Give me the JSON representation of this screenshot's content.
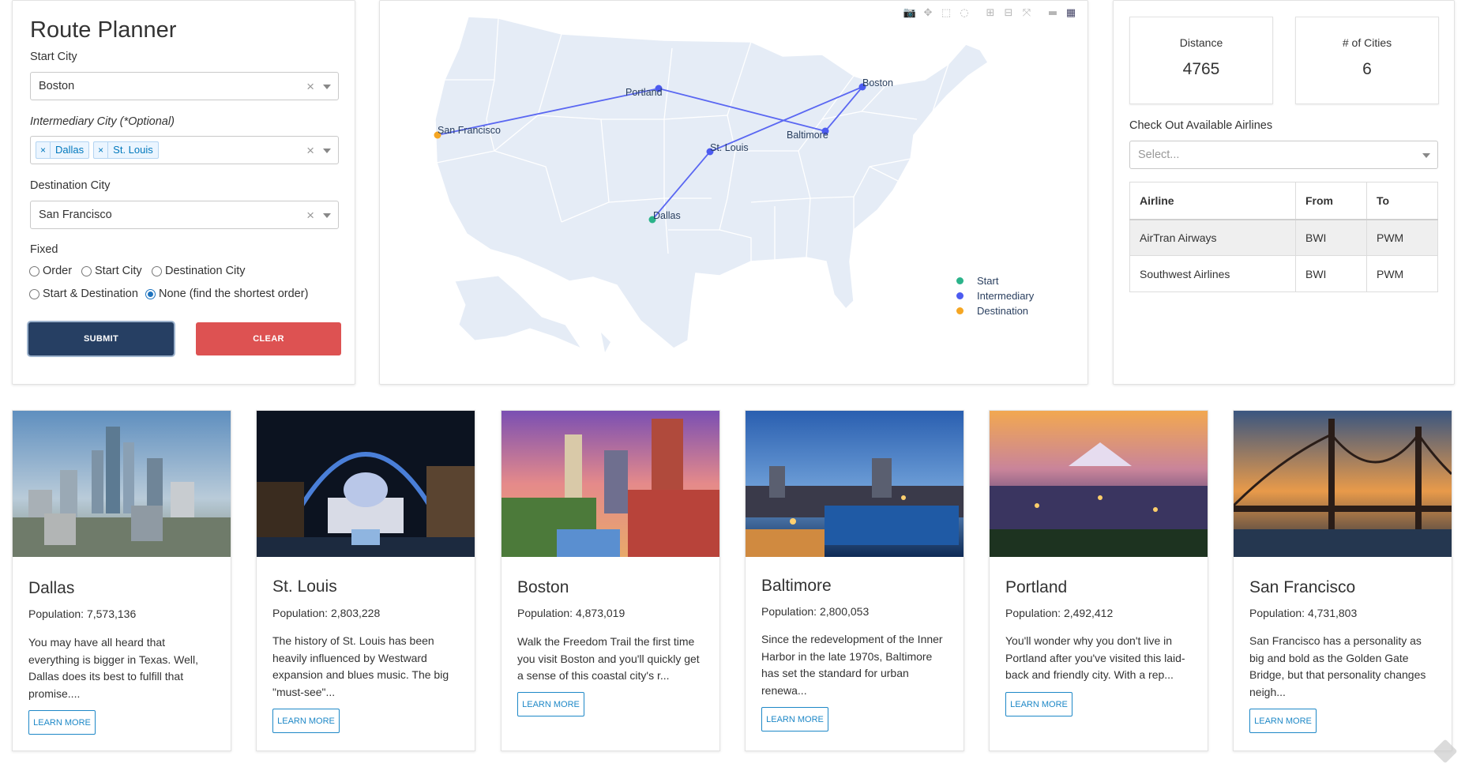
{
  "planner": {
    "title": "Route Planner",
    "start_label": "Start City",
    "start_value": "Boston",
    "intermediary_label": "Intermediary City (*Optional)",
    "intermediary_chips": [
      "Dallas",
      "St. Louis"
    ],
    "destination_label": "Destination City",
    "destination_value": "San Francisco",
    "fixed_label": "Fixed",
    "radios": [
      {
        "label": "Order",
        "checked": false
      },
      {
        "label": "Start City",
        "checked": false
      },
      {
        "label": "Destination City",
        "checked": false
      },
      {
        "label": "Start & Destination",
        "checked": false
      },
      {
        "label": "None (find the shortest order)",
        "checked": true
      }
    ],
    "submit_label": "SUBMIT",
    "clear_label": "CLEAR"
  },
  "map": {
    "cities": {
      "san_francisco": "San Francisco",
      "portland": "Portland",
      "boston": "Boston",
      "baltimore": "Baltimore",
      "st_louis": "St. Louis",
      "dallas": "Dallas"
    },
    "legend": [
      {
        "label": "Start",
        "color": "#2bb38a"
      },
      {
        "label": "Intermediary",
        "color": "#4c5bf0"
      },
      {
        "label": "Destination",
        "color": "#f5a623"
      }
    ],
    "route_color": "#5a67f2"
  },
  "info": {
    "distance_label": "Distance",
    "distance_value": "4765",
    "cities_label": "# of Cities",
    "cities_value": "6",
    "airlines_label": "Check Out Available Airlines",
    "airlines_placeholder": "Select...",
    "table_headers": [
      "Airline",
      "From",
      "To"
    ],
    "table_rows": [
      [
        "AirTran Airways",
        "BWI",
        "PWM"
      ],
      [
        "Southwest Airlines",
        "BWI",
        "PWM"
      ]
    ]
  },
  "city_cards": [
    {
      "name": "Dallas",
      "population": "Population: 7,573,136",
      "desc": "You may have all heard that everything is bigger in Texas. Well, Dallas does its best to fulfill that promise....",
      "button": "LEARN MORE"
    },
    {
      "name": "St. Louis",
      "population": "Population: 2,803,228",
      "desc": "The history of St. Louis has been heavily influenced by Westward expansion and blues music. The big \"must-see\"...",
      "button": "LEARN MORE"
    },
    {
      "name": "Boston",
      "population": "Population: 4,873,019",
      "desc": "Walk the Freedom Trail the first time you visit Boston and you'll quickly get a sense of this coastal city's r...",
      "button": "LEARN MORE"
    },
    {
      "name": "Baltimore",
      "population": "Population: 2,800,053",
      "desc": "Since the redevelopment of the Inner Harbor in the late 1970s, Baltimore has set the standard for urban renewa...",
      "button": "LEARN MORE"
    },
    {
      "name": "Portland",
      "population": "Population: 2,492,412",
      "desc": "You'll wonder why you don't live in Portland after you've visited this laid-back and friendly city. With a rep...",
      "button": "LEARN MORE"
    },
    {
      "name": "San Francisco",
      "population": "Population: 4,731,803",
      "desc": "San Francisco has a personality as big and bold as the Golden Gate Bridge, but that personality changes neigh...",
      "button": "LEARN MORE"
    }
  ]
}
